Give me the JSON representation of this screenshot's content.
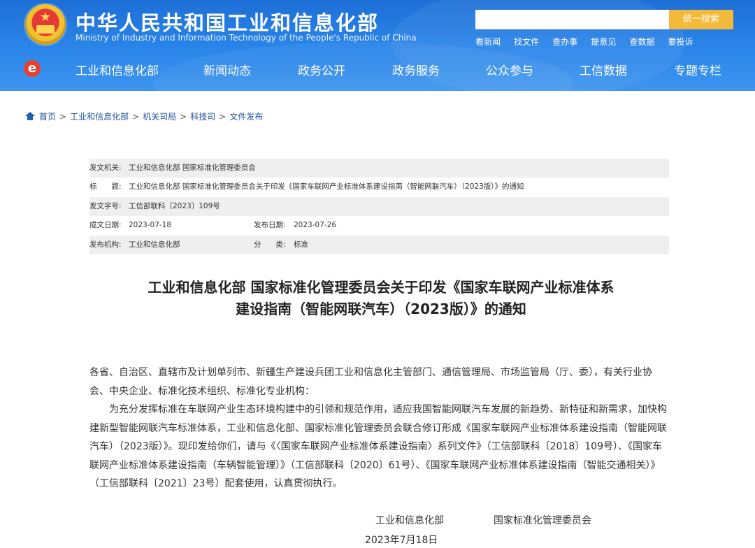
{
  "header": {
    "site_title": "中华人民共和国工业和信息化部",
    "site_subtitle": "Ministry of Industry and Information Technology of the People's Republic of China",
    "search": {
      "placeholder": "",
      "button_label": "统一搜索"
    },
    "quick_links": [
      "看新闻",
      "找文件",
      "查办事",
      "提意见",
      "查数据",
      "要投诉"
    ],
    "nav": [
      "工业和信息化部",
      "新闻动态",
      "政务公开",
      "政务服务",
      "公众参与",
      "工信数据",
      "专题专栏"
    ],
    "colors": {
      "header_blue": "#2b86ea",
      "search_button": "#f4b93a",
      "logo_red": "#e6402f"
    }
  },
  "breadcrumb": [
    "首页",
    "工业和信息化部",
    "机关司局",
    "科技司",
    "文件发布"
  ],
  "meta": {
    "issuer_label": "发文机关:",
    "issuer": "工业和信息化部 国家标准化管理委员会",
    "title_label": "标　　题:",
    "title": "工业和信息化部 国家标准化管理委员会关于印发《国家车联网产业标准体系建设指南（智能网联汽车）（2023版）》的通知",
    "doc_no_label": "发文字号:",
    "doc_no": "工信部联科〔2023〕109号",
    "written_date_label": "成文日期:",
    "written_date": "2023-07-18",
    "publish_date_label": "发布日期:",
    "publish_date": "2023-07-26",
    "publisher_label": "发布机构:",
    "publisher": "工业和信息化部",
    "category_label": "分　　类:",
    "category": "标准"
  },
  "article": {
    "title_line1": "工业和信息化部 国家标准化管理委员会关于印发《国家车联网产业标准体系",
    "title_line2": "建设指南（智能网联汽车）（2023版）》的通知",
    "addressee": "各省、自治区、直辖市及计划单列市、新疆生产建设兵团工业和信息化主管部门、通信管理局、市场监管局（厅、委），有关行业协会、中央企业、标准化技术组织、标准化专业机构：",
    "paragraph": "为充分发挥标准在车联网产业生态环境构建中的引领和规范作用，适应我国智能网联汽车发展的新趋势、新特征和新需求，加快构建新型智能网联汽车标准体系，工业和信息化部、国家标准化管理委员会联合修订形成《国家车联网产业标准体系建设指南（智能网联汽车）（2023版）》。现印发给你们，请与《〈国家车联网产业标准体系建设指南〉系列文件》（工信部联科〔2018〕109号）、《国家车联网产业标准体系建设指南（车辆智能管理）》（工信部联科〔2020〕61号）、《国家车联网产业标准体系建设指南（智能交通相关）》（工信部联科〔2021〕23号）配套使用，认真贯彻执行。",
    "signer1": "工业和信息化部",
    "signer2": "国家标准化管理委员会",
    "date": "2023年7月18日"
  }
}
